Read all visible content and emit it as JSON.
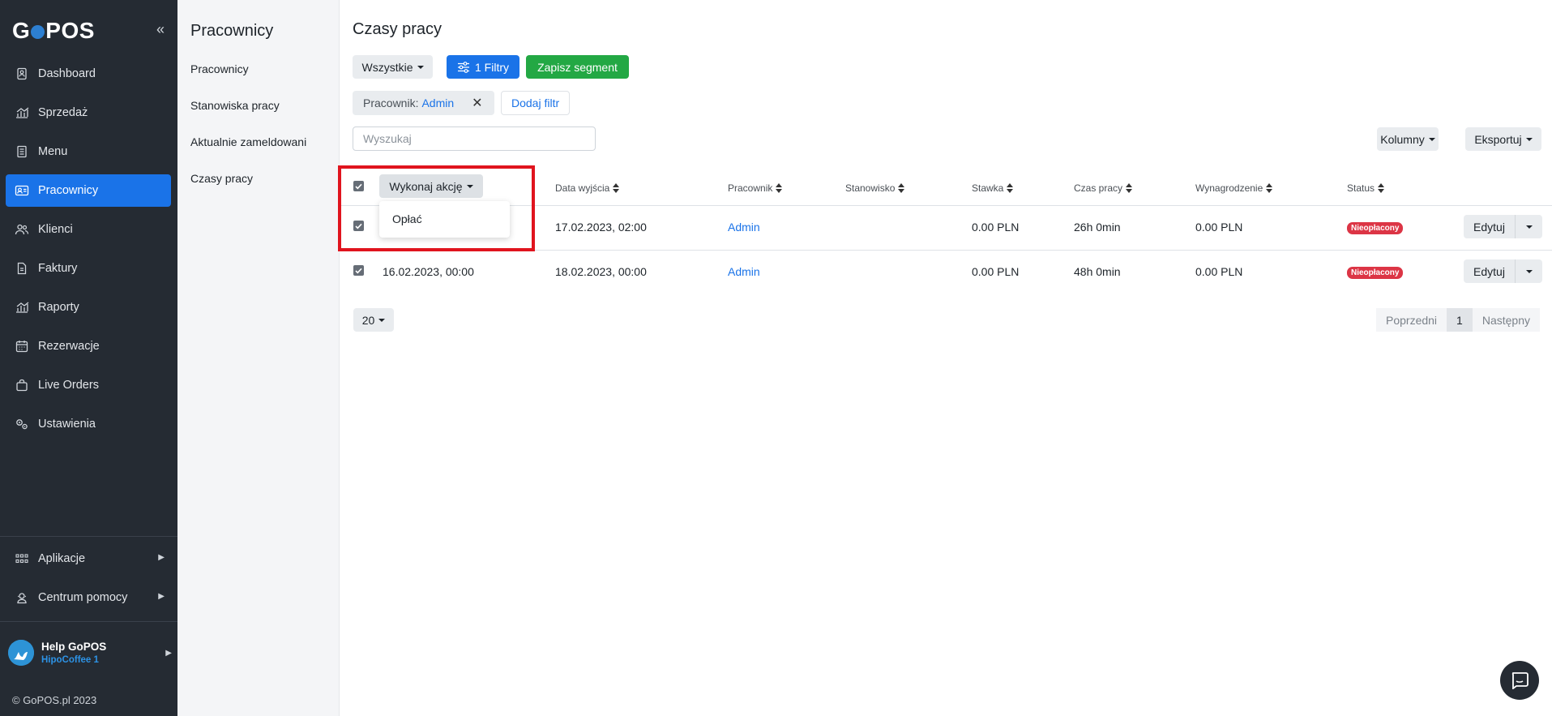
{
  "app": {
    "logo": "GoPOS",
    "copyright": "© GoPOS.pl 2023"
  },
  "sidebar": {
    "items": [
      {
        "label": "Dashboard",
        "icon": "dashboard-icon"
      },
      {
        "label": "Sprzedaż",
        "icon": "sales-chart-icon"
      },
      {
        "label": "Menu",
        "icon": "menu-icon"
      },
      {
        "label": "Pracownicy",
        "icon": "employees-icon",
        "active": true
      },
      {
        "label": "Klienci",
        "icon": "clients-icon"
      },
      {
        "label": "Faktury",
        "icon": "invoice-icon"
      },
      {
        "label": "Raporty",
        "icon": "reports-icon"
      },
      {
        "label": "Rezerwacje",
        "icon": "calendar-icon"
      },
      {
        "label": "Live Orders",
        "icon": "bag-icon"
      },
      {
        "label": "Ustawienia",
        "icon": "settings-icon"
      }
    ],
    "bottom": [
      {
        "label": "Aplikacje",
        "icon": "apps-icon"
      },
      {
        "label": "Centrum pomocy",
        "icon": "help-icon"
      }
    ],
    "user": {
      "name": "Help GoPOS",
      "org": "HipoCoffee 1"
    }
  },
  "subnav": {
    "title": "Pracownicy",
    "links": [
      "Pracownicy",
      "Stanowiska pracy",
      "Aktualnie zameldowani",
      "Czasy pracy"
    ]
  },
  "page": {
    "title": "Czasy pracy",
    "segment_dropdown": "Wszystkie",
    "filters_button": "1 Filtry",
    "save_segment": "Zapisz segment",
    "filter_chip": {
      "key": "Pracownik:",
      "value": "Admin"
    },
    "add_filter": "Dodaj filtr",
    "search_placeholder": "Wyszukaj",
    "columns_button": "Kolumny",
    "export_button": "Eksportuj",
    "action_button": "Wykonaj akcję",
    "action_menu": [
      "Opłać"
    ]
  },
  "table": {
    "headers": [
      "Data wyjścia",
      "Pracownik",
      "Stanowisko",
      "Stawka",
      "Czas pracy",
      "Wynagrodzenie",
      "Status"
    ],
    "rows": [
      {
        "start": "",
        "end": "17.02.2023, 02:00",
        "employee": "Admin",
        "position": "",
        "rate": "0.00 PLN",
        "time": "26h 0min",
        "salary": "0.00 PLN",
        "status": "Nieopłacony",
        "edit": "Edytuj",
        "checked": true
      },
      {
        "start": "16.02.2023, 00:00",
        "end": "18.02.2023, 00:00",
        "employee": "Admin",
        "position": "",
        "rate": "0.00 PLN",
        "time": "48h 0min",
        "salary": "0.00 PLN",
        "status": "Nieopłacony",
        "edit": "Edytuj",
        "checked": true
      }
    ]
  },
  "pagination": {
    "page_size": "20",
    "prev": "Poprzedni",
    "current": "1",
    "next": "Następny"
  },
  "colors": {
    "sidebar_bg": "#252b33",
    "accent": "#1a73e8",
    "success": "#23a844",
    "danger": "#dc3545",
    "highlight": "#e0141e"
  }
}
